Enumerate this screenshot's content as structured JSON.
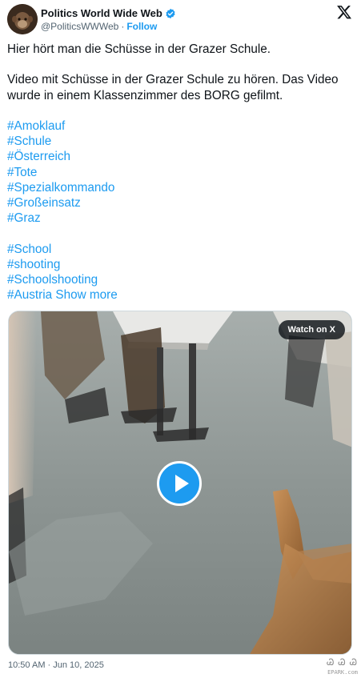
{
  "author": {
    "display_name": "Politics World Wide Web",
    "handle": "@PoliticsWWWeb",
    "separator": "·",
    "follow_label": "Follow",
    "verified_color": "#1d9bf0"
  },
  "icons": {
    "brand": "x-logo-icon",
    "verified": "verified-badge-icon",
    "play": "play-icon"
  },
  "tweet": {
    "line1": "Hier hört man die Schüsse in der Grazer Schule.",
    "line2": "Video mit Schüsse in der Grazer Schule zu hören. Das Video",
    "line3": "wurde in einem Klassenzimmer des BORG gefilmt.",
    "hashtags_group1": [
      "#Amoklauf",
      "#Schule",
      "#Österreich",
      "#Tote",
      "#Spezialkommando",
      "#Großeinsatz",
      "#Graz"
    ],
    "hashtags_group2": [
      "#School",
      "#shooting",
      "#Schoolshooting",
      "#Austria"
    ],
    "show_more": "Show more"
  },
  "media": {
    "watch_label": "Watch on X"
  },
  "timestamp": "10:50 AM · Jun 10, 2025",
  "watermark": {
    "glyphs": "Ꮚ Ꮚ Ꮚ",
    "subtext": "EPARK.com"
  },
  "colors": {
    "accent": "#1d9bf0",
    "text": "#0f1419",
    "secondary": "#536471"
  }
}
